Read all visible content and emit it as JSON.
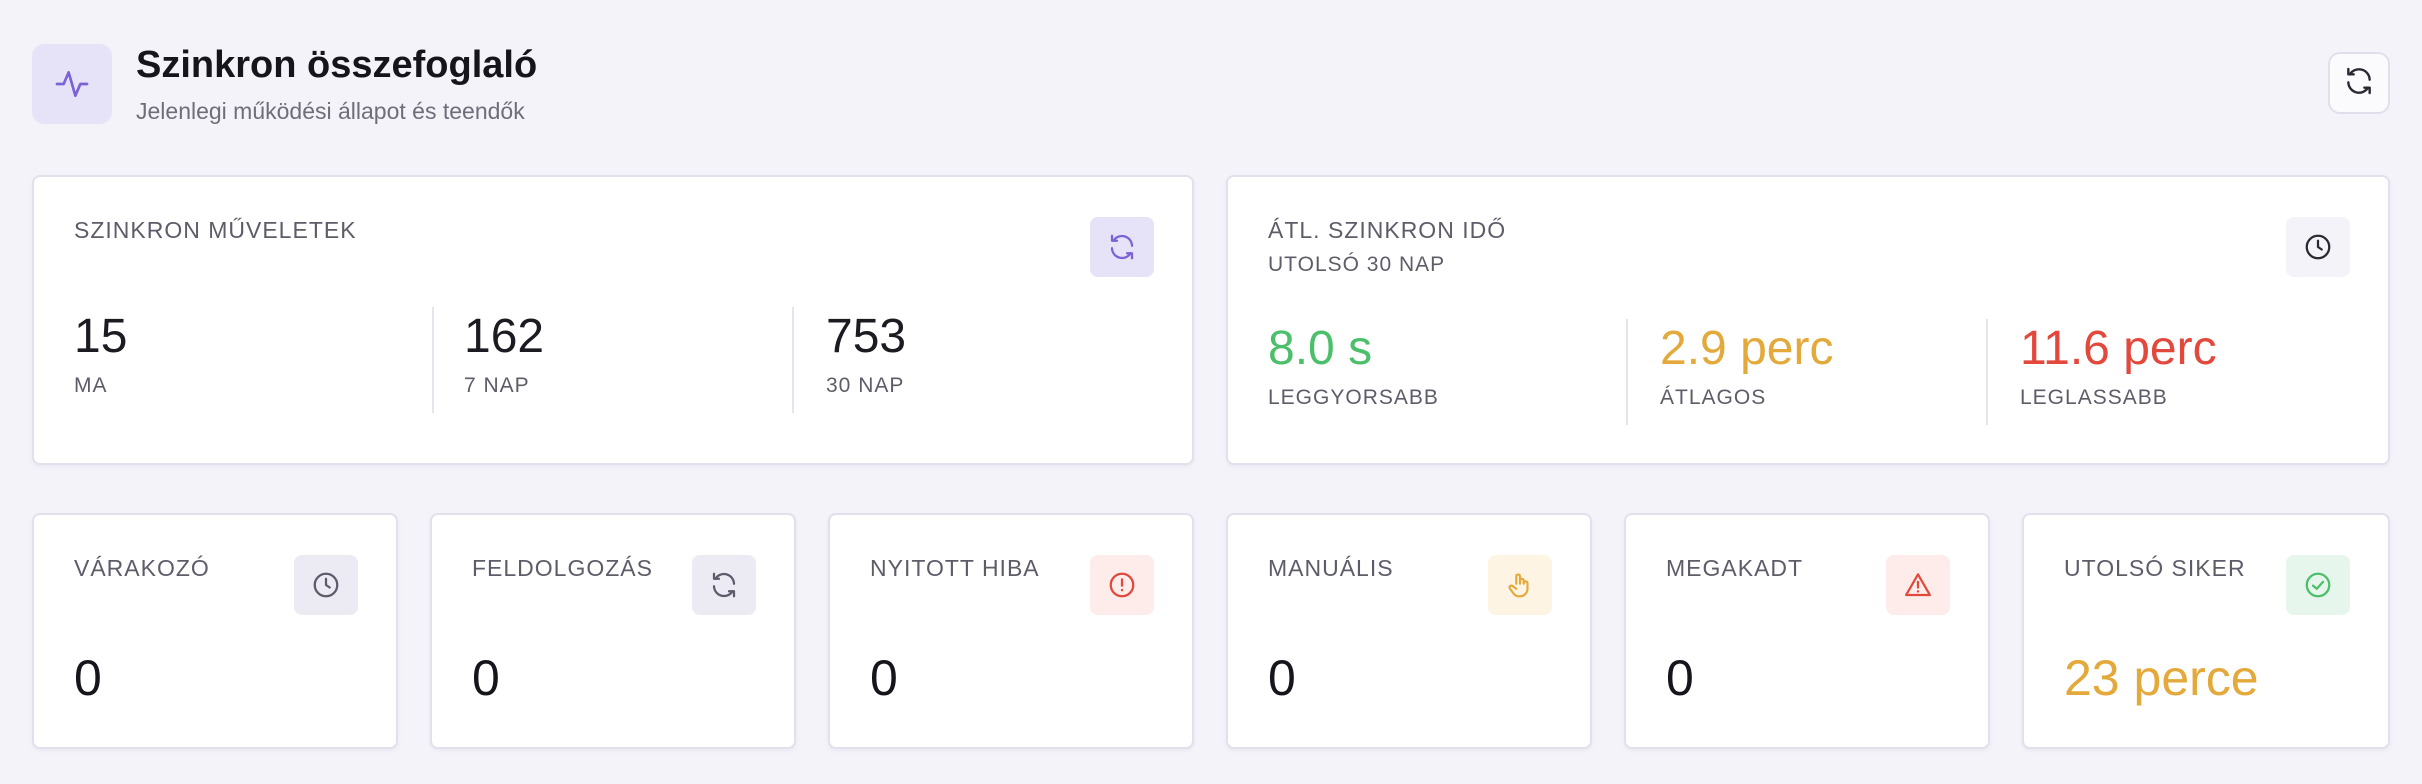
{
  "header": {
    "title": "Szinkron összefoglaló",
    "subtitle": "Jelenlegi működési állapot és teendők",
    "icon": "activity-icon",
    "refresh_icon": "refresh-icon"
  },
  "ops_card": {
    "title": "SZINKRON MŰVELETEK",
    "icon": "refresh-icon",
    "metrics": [
      {
        "value": "15",
        "label": "MA"
      },
      {
        "value": "162",
        "label": "7 NAP"
      },
      {
        "value": "753",
        "label": "30 NAP"
      }
    ]
  },
  "time_card": {
    "title": "ÁTL. SZINKRON IDŐ",
    "subtitle": "UTOLSÓ 30 NAP",
    "icon": "clock-icon",
    "metrics": [
      {
        "value": "8.0 s",
        "label": "LEGGYORSABB",
        "color": "#4cbf6b"
      },
      {
        "value": "2.9 perc",
        "label": "ÁTLAGOS",
        "color": "#e3a93a"
      },
      {
        "value": "11.6 perc",
        "label": "LEGLASSABB",
        "color": "#e2483b"
      }
    ]
  },
  "status_cards": [
    {
      "label": "VÁRAKOZÓ",
      "value": "0",
      "icon": "clock-icon",
      "value_color": "#16151c",
      "badge_bg": "#ecebf4",
      "icon_color": "#5d5b6a"
    },
    {
      "label": "FELDOLGOZÁS",
      "value": "0",
      "icon": "refresh-icon",
      "value_color": "#16151c",
      "badge_bg": "#ecebf4",
      "icon_color": "#5d5b6a"
    },
    {
      "label": "NYITOTT HIBA",
      "value": "0",
      "icon": "alert-circle-icon",
      "value_color": "#16151c",
      "badge_bg": "#fdecea",
      "icon_color": "#e2483b"
    },
    {
      "label": "MANUÁLIS",
      "value": "0",
      "icon": "hand-pointer-icon",
      "value_color": "#16151c",
      "badge_bg": "#fdf4e3",
      "icon_color": "#e3a93a"
    },
    {
      "label": "MEGAKADT",
      "value": "0",
      "icon": "warning-triangle-icon",
      "value_color": "#16151c",
      "badge_bg": "#fdecea",
      "icon_color": "#e2483b"
    },
    {
      "label": "UTOLSÓ SIKER",
      "value": "23 perce",
      "icon": "check-circle-icon",
      "value_color": "#e3a93a",
      "badge_bg": "#e7f6ec",
      "icon_color": "#4cbf6b"
    }
  ]
}
